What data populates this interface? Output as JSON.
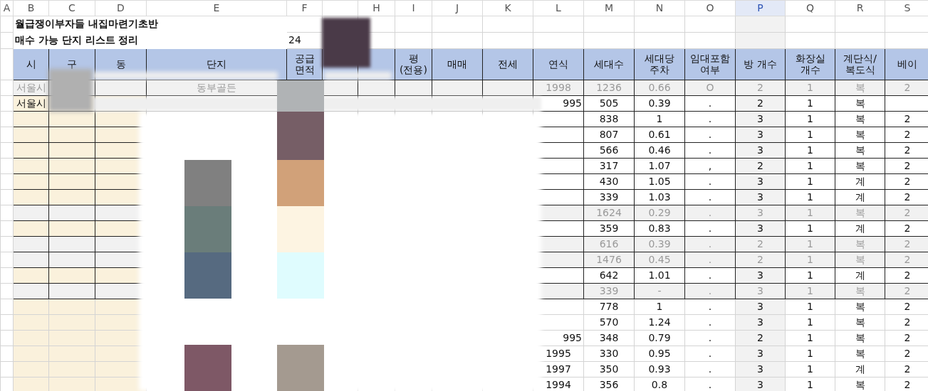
{
  "columns": [
    {
      "letter": "A",
      "selected": false
    },
    {
      "letter": "B",
      "selected": false
    },
    {
      "letter": "C",
      "selected": false
    },
    {
      "letter": "D",
      "selected": false
    },
    {
      "letter": "E",
      "selected": false
    },
    {
      "letter": "F",
      "selected": false
    },
    {
      "letter": "H",
      "selected": false
    },
    {
      "letter": "I",
      "selected": false
    },
    {
      "letter": "J",
      "selected": false
    },
    {
      "letter": "K",
      "selected": false
    },
    {
      "letter": "L",
      "selected": false
    },
    {
      "letter": "M",
      "selected": false
    },
    {
      "letter": "N",
      "selected": false
    },
    {
      "letter": "O",
      "selected": false
    },
    {
      "letter": "P",
      "selected": true
    },
    {
      "letter": "Q",
      "selected": false
    },
    {
      "letter": "R",
      "selected": false
    },
    {
      "letter": "S",
      "selected": false
    }
  ],
  "titles": [
    "월급쟁이부자들 내집마련기초반",
    "매수 가능 단지 리스트 정리"
  ],
  "title_note": "24",
  "headers": {
    "B": "시",
    "C": "구",
    "D": "동",
    "E": "단지",
    "F": "공급\n면적",
    "I": "평\n(전용)",
    "J": "매매",
    "K": "전세",
    "L": "연식",
    "M": "세대수",
    "N": "세대당\n주차",
    "O": "임대포함\n여부",
    "P": "방 개수",
    "Q": "화장실\n개수",
    "R": "계단식/\n복도식",
    "S": "베이"
  },
  "rows": [
    {
      "greyed": true,
      "outlined": true,
      "cells": {
        "B": "서울시",
        "E": "동부골든",
        "L": "1998",
        "M": "1236",
        "N": "0.66",
        "O": "O",
        "P": "2",
        "Q": "1",
        "R": "복",
        "S": "2"
      }
    },
    {
      "greyed": false,
      "outlined": true,
      "cells": {
        "B": "서울시",
        "L": "995",
        "M": "505",
        "N": "0.39",
        "O": ".",
        "P": "2",
        "Q": "1",
        "R": "복"
      }
    },
    {
      "greyed": false,
      "outlined": true,
      "cells": {
        "M": "838",
        "N": "1",
        "O": ".",
        "P": "3",
        "Q": "1",
        "R": "복",
        "S": "2"
      }
    },
    {
      "greyed": false,
      "outlined": true,
      "cells": {
        "M": "807",
        "N": "0.61",
        "O": ".",
        "P": "3",
        "Q": "1",
        "R": "복",
        "S": "2"
      }
    },
    {
      "greyed": false,
      "outlined": true,
      "cells": {
        "M": "566",
        "N": "0.46",
        "O": ".",
        "P": "3",
        "Q": "1",
        "R": "복",
        "S": "2"
      }
    },
    {
      "greyed": false,
      "outlined": true,
      "cells": {
        "M": "317",
        "N": "1.07",
        "O": ",",
        "P": "2",
        "Q": "1",
        "R": "복",
        "S": "2"
      }
    },
    {
      "greyed": false,
      "outlined": true,
      "cells": {
        "M": "430",
        "N": "1.05",
        "O": ".",
        "P": "3",
        "Q": "1",
        "R": "계",
        "S": "2"
      }
    },
    {
      "greyed": false,
      "outlined": true,
      "cells": {
        "M": "339",
        "N": "1.03",
        "O": ".",
        "P": "3",
        "Q": "1",
        "R": "계",
        "S": "2"
      }
    },
    {
      "greyed": true,
      "outlined": true,
      "cells": {
        "M": "1624",
        "N": "0.29",
        "O": ".",
        "P": "3",
        "Q": "1",
        "R": "복",
        "S": "2"
      }
    },
    {
      "greyed": false,
      "outlined": true,
      "cells": {
        "M": "359",
        "N": "0.83",
        "O": ".",
        "P": "3",
        "Q": "1",
        "R": "계",
        "S": "2"
      }
    },
    {
      "greyed": true,
      "outlined": true,
      "cells": {
        "M": "616",
        "N": "0.39",
        "O": ".",
        "P": "2",
        "Q": "1",
        "R": "복",
        "S": "2"
      }
    },
    {
      "greyed": true,
      "outlined": true,
      "cells": {
        "M": "1476",
        "N": "0.45",
        "O": ".",
        "P": "2",
        "Q": "1",
        "R": "복",
        "S": "2"
      }
    },
    {
      "greyed": false,
      "outlined": true,
      "cells": {
        "M": "642",
        "N": "1.01",
        "O": ".",
        "P": "3",
        "Q": "1",
        "R": "계",
        "S": "2"
      }
    },
    {
      "greyed": true,
      "outlined": true,
      "cells": {
        "M": "339",
        "N": "-",
        "O": ".",
        "P": "3",
        "Q": "1",
        "R": "복",
        "S": "2"
      }
    },
    {
      "greyed": false,
      "outlined": false,
      "cells": {
        "M": "778",
        "N": "1",
        "O": ".",
        "P": "3",
        "Q": "1",
        "R": "복",
        "S": "2"
      }
    },
    {
      "greyed": false,
      "outlined": false,
      "cells": {
        "M": "570",
        "N": "1.24",
        "O": ".",
        "P": "3",
        "Q": "1",
        "R": "복",
        "S": "2"
      }
    },
    {
      "greyed": false,
      "outlined": false,
      "cells": {
        "L": "995",
        "M": "348",
        "N": "0.79",
        "O": ".",
        "P": "2",
        "Q": "1",
        "R": "복",
        "S": "2"
      }
    },
    {
      "greyed": false,
      "outlined": false,
      "cells": {
        "L": "1995",
        "M": "330",
        "N": "0.95",
        "O": ".",
        "P": "3",
        "Q": "1",
        "R": "복",
        "S": "2"
      }
    },
    {
      "greyed": false,
      "outlined": false,
      "cells": {
        "L": "1997",
        "M": "350",
        "N": "0.93",
        "O": ".",
        "P": "3",
        "Q": "1",
        "R": "계",
        "S": "2"
      }
    },
    {
      "greyed": false,
      "outlined": false,
      "cells": {
        "L": "1994",
        "M": "356",
        "N": "0.8",
        "O": ".",
        "P": "3",
        "Q": "1",
        "R": "복",
        "S": "2"
      }
    }
  ]
}
